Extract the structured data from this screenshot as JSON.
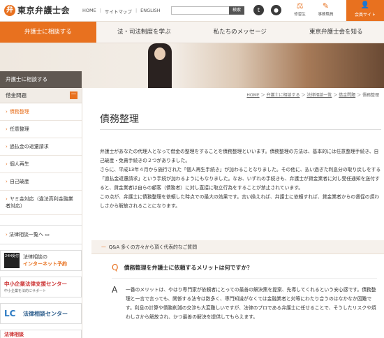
{
  "header": {
    "logo_mark": "弁",
    "logo_text": "東京弁護士会",
    "links": [
      "HOME",
      "サイトマップ",
      "ENGLISH"
    ],
    "search_placeholder": "",
    "search_button": "検索",
    "twitter_icon": "twitter-icon",
    "map_icon": "map-pin-icon",
    "trainee_label": "修習生",
    "staff_label": "事務職員",
    "member_label": "会員サイト"
  },
  "nav": {
    "items": [
      "弁護士に相談する",
      "法・司法制度を学ぶ",
      "私たちのメッセージ",
      "東京弁護士会を知る"
    ]
  },
  "hero": {
    "label": "弁護士に相談する"
  },
  "sidebar": {
    "head": "借金問題",
    "toggle": "－",
    "items": [
      "債務整理",
      "任意整理",
      "過払金の返還請求",
      "個人再生",
      "自己破産",
      "ヤミ金対応（違法高利金融業者対応）"
    ],
    "list_link": "法律相談一覧へ",
    "banner1_badge": "24H受付",
    "banner1_line1": "法律相談の",
    "banner1_line2": "インターネット予約",
    "banner2_title": "中小企業法律支援センター",
    "banner2_sub": "中小企業を法的にサポート",
    "banner3_mark": "LC",
    "banner3_title": "法律相談センター",
    "banner4_title": "法律相談"
  },
  "content": {
    "breadcrumb": [
      "HOME",
      "弁護士に相談する",
      "法律相談一覧",
      "借金問題",
      "債務整理"
    ],
    "title": "債務整理",
    "paragraph1": "弁護士があなたの代理人となって借金の整理をすることを債務整理といいます。債務整理の方法は、基本的には任意整理手続き、自己破産・免責手続きの２つがありました。",
    "paragraph2": "さらに、平成13年４月から施行された「個人再生手続き」が加わることなりました。その他に、払い過ぎた利息分の取り戻しをする「過払金返還請求」という手続が加わるようにもなりました。なお、いずれの手続きも、弁護士が貸金業者に対し受任通知を送付すると、貸金業者は自らの顧客（債務者）に対し直接に取立行為をすることが禁止されています。",
    "paragraph3": "この点が、弁護士に債務整理を依頼した時点での最大の効果です。言い換えれば、弁護士に依頼すれば、貸金業者からの督促の煩わしさから解放されることになります。",
    "qa_heading": "Q&A 多くの方々から頂く代表的なご質問",
    "q_mark": "Q",
    "question": "債務整理を弁護士に依頼するメリットは何ですか？",
    "a_mark": "A",
    "answer": "一番のメリットは、やはり専門家が依頼者にとっての最善の解決策を提案、先導してくれるという安心感です。債務整理と一言で言っても、関係する法令は数多く、専門知識がなくては金融業者と対等にわたり合うのはなかなか困難です。利息の計算や債務削減の交渉も大変難しいですが、法律のプロである弁護士に任せることで、そうしたリスクや煩わしさから解放され、かつ最善の解決を提供してもらえます。"
  }
}
